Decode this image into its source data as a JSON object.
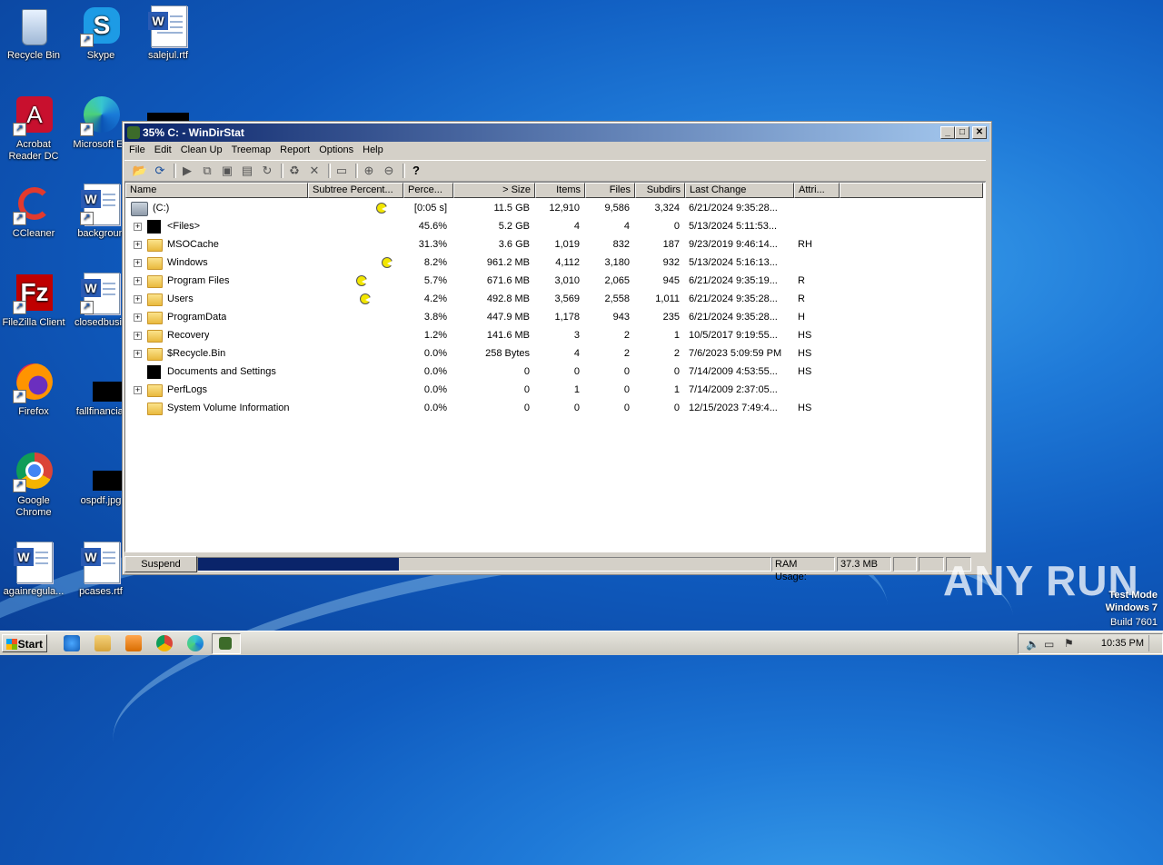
{
  "desktop": {
    "icons": [
      {
        "label": "Recycle Bin"
      },
      {
        "label": "Skype"
      },
      {
        "label": "salejul.rtf"
      },
      {
        "label": "Acrobat Reader DC"
      },
      {
        "label": "Microsoft Ed"
      },
      {
        "label": "CCleaner"
      },
      {
        "label": "backgroun"
      },
      {
        "label": "FileZilla Client"
      },
      {
        "label": "closedbusin"
      },
      {
        "label": "Firefox"
      },
      {
        "label": "fallfinancial"
      },
      {
        "label": "Google Chrome"
      },
      {
        "label": "ospdf.jpg"
      },
      {
        "label": "againregula..."
      },
      {
        "label": "pcases.rtf"
      }
    ]
  },
  "window": {
    "title": "35% C: - WinDirStat",
    "menu": [
      "File",
      "Edit",
      "Clean Up",
      "Treemap",
      "Report",
      "Options",
      "Help"
    ],
    "columns": [
      "Name",
      "Subtree Percent...",
      "Perce...",
      "> Size",
      "Items",
      "Files",
      "Subdirs",
      "Last Change",
      "Attri..."
    ],
    "rows": [
      {
        "name": "(C:)",
        "pct": "[0:05 s]",
        "size": "11.5 GB",
        "items": "12,910",
        "files": "9,586",
        "subdirs": "3,324",
        "last": "6/21/2024  9:35:28...",
        "attr": ""
      },
      {
        "name": "<Files>",
        "pct": "45.6%",
        "size": "5.2 GB",
        "items": "4",
        "files": "4",
        "subdirs": "0",
        "last": "5/13/2024  5:11:53...",
        "attr": ""
      },
      {
        "name": "MSOCache",
        "pct": "31.3%",
        "size": "3.6 GB",
        "items": "1,019",
        "files": "832",
        "subdirs": "187",
        "last": "9/23/2019  9:46:14...",
        "attr": "RH"
      },
      {
        "name": "Windows",
        "pct": "8.2%",
        "size": "961.2 MB",
        "items": "4,112",
        "files": "3,180",
        "subdirs": "932",
        "last": "5/13/2024  5:16:13...",
        "attr": ""
      },
      {
        "name": "Program Files",
        "pct": "5.7%",
        "size": "671.6 MB",
        "items": "3,010",
        "files": "2,065",
        "subdirs": "945",
        "last": "6/21/2024  9:35:19...",
        "attr": "R"
      },
      {
        "name": "Users",
        "pct": "4.2%",
        "size": "492.8 MB",
        "items": "3,569",
        "files": "2,558",
        "subdirs": "1,011",
        "last": "6/21/2024  9:35:28...",
        "attr": "R"
      },
      {
        "name": "ProgramData",
        "pct": "3.8%",
        "size": "447.9 MB",
        "items": "1,178",
        "files": "943",
        "subdirs": "235",
        "last": "6/21/2024  9:35:28...",
        "attr": "H"
      },
      {
        "name": "Recovery",
        "pct": "1.2%",
        "size": "141.6 MB",
        "items": "3",
        "files": "2",
        "subdirs": "1",
        "last": "10/5/2017  9:19:55...",
        "attr": "HS"
      },
      {
        "name": "$Recycle.Bin",
        "pct": "0.0%",
        "size": "258 Bytes",
        "items": "4",
        "files": "2",
        "subdirs": "2",
        "last": "7/6/2023  5:09:59 PM",
        "attr": "HS"
      },
      {
        "name": "Documents and Settings",
        "pct": "0.0%",
        "size": "0",
        "items": "0",
        "files": "0",
        "subdirs": "0",
        "last": "7/14/2009  4:53:55...",
        "attr": "HS"
      },
      {
        "name": "PerfLogs",
        "pct": "0.0%",
        "size": "0",
        "items": "1",
        "files": "0",
        "subdirs": "1",
        "last": "7/14/2009  2:37:05...",
        "attr": ""
      },
      {
        "name": "System Volume Information",
        "pct": "0.0%",
        "size": "0",
        "items": "0",
        "files": "0",
        "subdirs": "0",
        "last": "12/15/2023  7:49:4...",
        "attr": "HS"
      }
    ],
    "status": {
      "suspend_label": "Suspend",
      "progress_fraction": 0.35,
      "ram_label": "RAM Usage:",
      "ram_value": "37.3 MB"
    }
  },
  "taskbar": {
    "start_label": "Start",
    "clock": "10:35 PM"
  },
  "watermark": {
    "line1": "Test Mode",
    "line2": "Windows 7",
    "line3": "Build 7601",
    "brand": "ANY RUN"
  }
}
